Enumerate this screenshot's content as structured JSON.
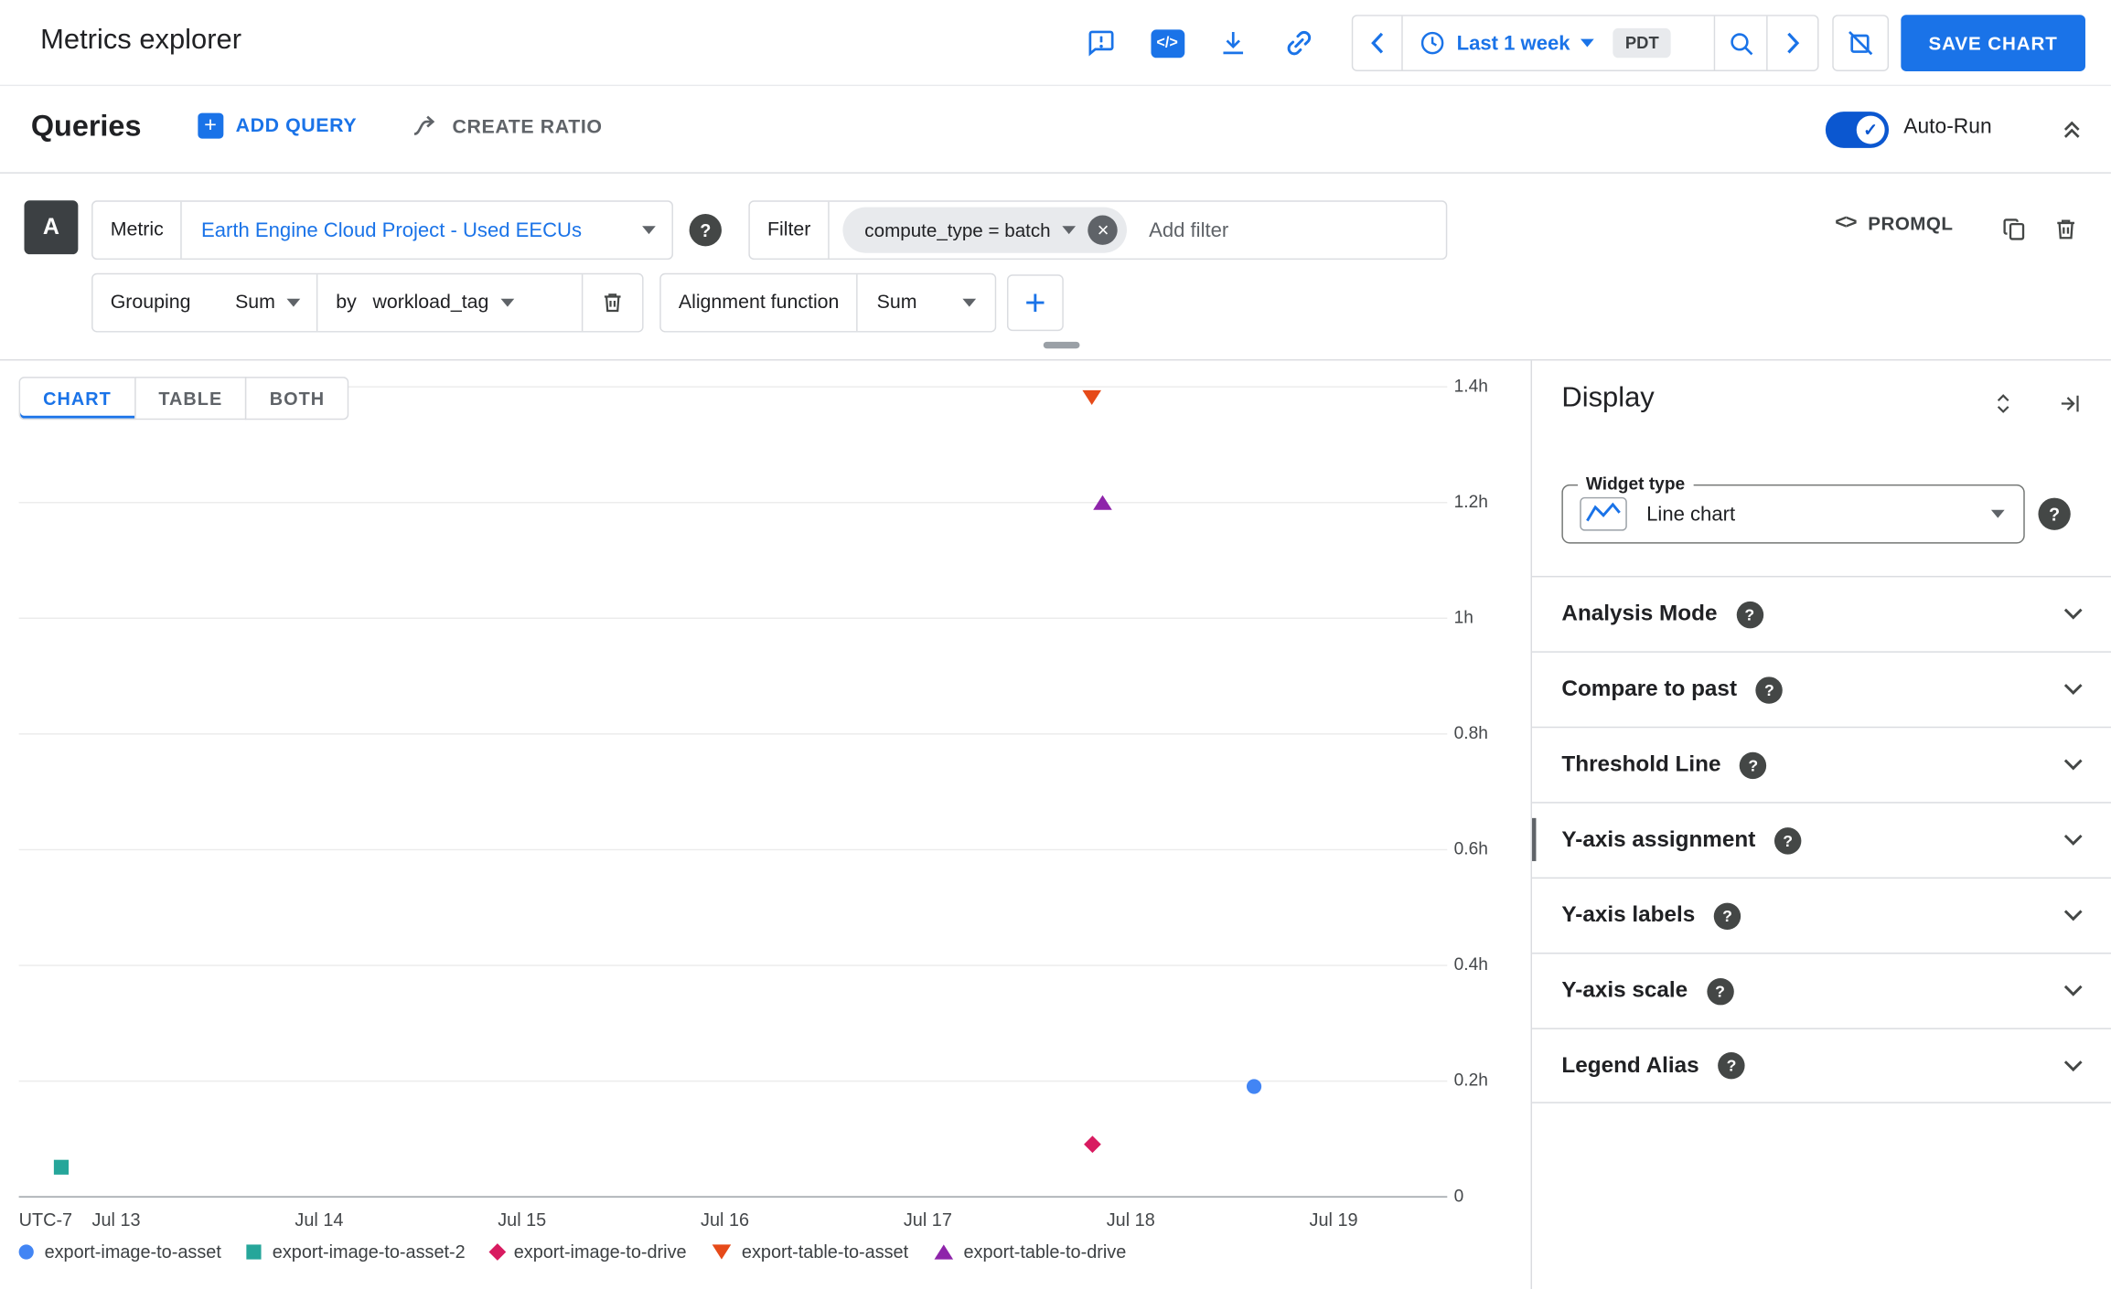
{
  "colors": {
    "accent_blue": "#1a73e8",
    "toggle_blue": "#0b57d0",
    "text_dark": "#202124",
    "text_grey": "#5f6368",
    "border": "#dadce0"
  },
  "glyphs": {
    "help": "?",
    "clear": "×",
    "plus": "+",
    "check": "✓",
    "code_badge": "</>",
    "promql_brackets": "<>"
  },
  "icons": {
    "feedback": "feedback-bubble",
    "view_as_code": "code-brackets",
    "download": "download-arrow",
    "link": "chain-link",
    "clock": "clock",
    "search": "magnifier",
    "prev": "chevron-left",
    "next": "chevron-right",
    "zoom_disabled": "zoom-off",
    "copy": "content-copy",
    "delete": "trash",
    "collapse_queries": "double-chevron-up",
    "section_expand": "chevron-down",
    "unfold": "unfold-vertical",
    "collapse_panel": "skip-to-right",
    "widget_line_chart": "sparkline",
    "drag_handle": "grip-bar"
  },
  "header": {
    "title": "Metrics explorer",
    "time_picker": {
      "label": "Last 1 week",
      "timezone_badge": "PDT"
    },
    "save_chart_button": "SAVE CHART"
  },
  "queries_bar": {
    "title": "Queries",
    "add_query_button": "ADD QUERY",
    "create_ratio_button": "CREATE RATIO",
    "auto_run_label": "Auto-Run"
  },
  "query_builder": {
    "query_letter": "A",
    "metric_label": "Metric",
    "metric_value": "Earth Engine Cloud Project - Used EECUs",
    "filter_label": "Filter",
    "filter_chip": "compute_type = batch",
    "add_filter_placeholder": "Add filter",
    "promql_label": "PROMQL",
    "grouping_label": "Grouping",
    "grouping_value": "Sum",
    "by_label": "by",
    "group_by_field": "workload_tag",
    "alignment_label": "Alignment function",
    "alignment_value": "Sum"
  },
  "view_tabs": {
    "chart": "CHART",
    "table": "TABLE",
    "both": "BOTH",
    "active": "CHART"
  },
  "chart_data": {
    "type": "scatter",
    "grid": true,
    "legend_position": "bottom",
    "x_axis": {
      "unit": "date (July, UTC-7)",
      "timezone_label": "UTC-7",
      "min": 12.52,
      "max": 19.56,
      "ticks": [
        {
          "label": "Jul 13",
          "value": 13
        },
        {
          "label": "Jul 14",
          "value": 14
        },
        {
          "label": "Jul 15",
          "value": 15
        },
        {
          "label": "Jul 16",
          "value": 16
        },
        {
          "label": "Jul 17",
          "value": 17
        },
        {
          "label": "Jul 18",
          "value": 18
        },
        {
          "label": "Jul 19",
          "value": 19
        }
      ]
    },
    "y_axis": {
      "unit": "hours",
      "min": 0,
      "max": 1.4,
      "ticks": [
        {
          "label": "1.4h",
          "value": 1.4
        },
        {
          "label": "1.2h",
          "value": 1.2
        },
        {
          "label": "1h",
          "value": 1.0
        },
        {
          "label": "0.8h",
          "value": 0.8
        },
        {
          "label": "0.6h",
          "value": 0.6
        },
        {
          "label": "0.4h",
          "value": 0.4
        },
        {
          "label": "0.2h",
          "value": 0.2
        },
        {
          "label": "0",
          "value": 0
        }
      ]
    },
    "series": [
      {
        "name": "export-image-to-asset",
        "marker": "circle",
        "color": "#4285f4",
        "points": [
          {
            "x": 18.61,
            "y": 0.19
          }
        ]
      },
      {
        "name": "export-image-to-asset-2",
        "marker": "square",
        "color": "#26a69a",
        "points": [
          {
            "x": 12.73,
            "y": 0.05
          }
        ]
      },
      {
        "name": "export-image-to-drive",
        "marker": "diamond",
        "color": "#d81b60",
        "points": [
          {
            "x": 17.81,
            "y": 0.09
          }
        ]
      },
      {
        "name": "export-table-to-asset",
        "marker": "triangle-down",
        "color": "#e64a19",
        "points": [
          {
            "x": 17.81,
            "y": 1.38
          }
        ]
      },
      {
        "name": "export-table-to-drive",
        "marker": "triangle-up",
        "color": "#8e24aa",
        "points": [
          {
            "x": 17.86,
            "y": 1.2
          }
        ]
      }
    ]
  },
  "display_panel": {
    "title": "Display",
    "widget_type_label": "Widget type",
    "widget_type_value": "Line chart",
    "sections": [
      {
        "label": "Analysis Mode",
        "slug": "analysis-mode"
      },
      {
        "label": "Compare to past",
        "slug": "compare-to-past"
      },
      {
        "label": "Threshold Line",
        "slug": "threshold-line"
      },
      {
        "label": "Y-axis assignment",
        "slug": "y-axis-assignment"
      },
      {
        "label": "Y-axis labels",
        "slug": "y-axis-labels"
      },
      {
        "label": "Y-axis scale",
        "slug": "y-axis-scale"
      },
      {
        "label": "Legend Alias",
        "slug": "legend-alias"
      }
    ]
  }
}
